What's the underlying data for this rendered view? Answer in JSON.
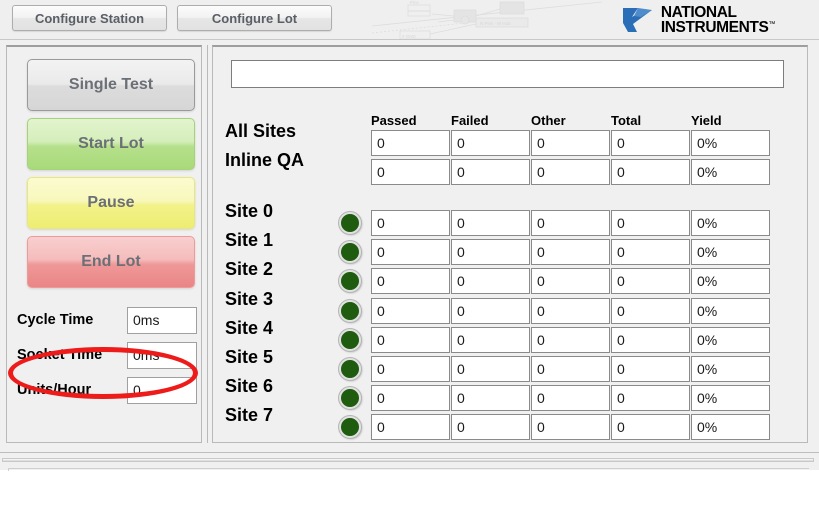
{
  "toolbar": {
    "configure_station_label": "Configure Station",
    "configure_lot_label": "Configure Lot",
    "logo_line1": "NATIONAL",
    "logo_line2": "INSTRUMENTS",
    "logo_tm": "™",
    "logo_color": "#2a6eb8"
  },
  "controls": {
    "single_test_label": "Single Test",
    "start_lot_label": "Start Lot",
    "pause_label": "Pause",
    "end_lot_label": "End Lot",
    "metrics": [
      {
        "label": "Cycle Time",
        "value": "0ms"
      },
      {
        "label": "Socket Time",
        "value": "0ms"
      },
      {
        "label": "Units/Hour",
        "value": "0"
      }
    ],
    "annotation_color": "#ee1b1b"
  },
  "status": {
    "message": "",
    "placeholder": ""
  },
  "table": {
    "columns": [
      "Passed",
      "Failed",
      "Other",
      "Total",
      "Yield"
    ],
    "summary_rows": [
      {
        "label": "All Sites",
        "values": [
          "0",
          "0",
          "0",
          "0",
          "0%"
        ]
      },
      {
        "label": "Inline QA",
        "values": [
          "0",
          "0",
          "0",
          "0",
          "0%"
        ]
      }
    ],
    "site_rows": [
      {
        "label": "Site 0",
        "led": "off",
        "values": [
          "0",
          "0",
          "0",
          "0",
          "0%"
        ]
      },
      {
        "label": "Site 1",
        "led": "off",
        "values": [
          "0",
          "0",
          "0",
          "0",
          "0%"
        ]
      },
      {
        "label": "Site 2",
        "led": "off",
        "values": [
          "0",
          "0",
          "0",
          "0",
          "0%"
        ]
      },
      {
        "label": "Site 3",
        "led": "off",
        "values": [
          "0",
          "0",
          "0",
          "0",
          "0%"
        ]
      },
      {
        "label": "Site 4",
        "led": "off",
        "values": [
          "0",
          "0",
          "0",
          "0",
          "0%"
        ]
      },
      {
        "label": "Site 5",
        "led": "off",
        "values": [
          "0",
          "0",
          "0",
          "0",
          "0%"
        ]
      },
      {
        "label": "Site 6",
        "led": "off",
        "values": [
          "0",
          "0",
          "0",
          "0",
          "0%"
        ]
      },
      {
        "label": "Site 7",
        "led": "off",
        "values": [
          "0",
          "0",
          "0",
          "0",
          "0%"
        ]
      }
    ],
    "led_color": "#1f5c10"
  }
}
